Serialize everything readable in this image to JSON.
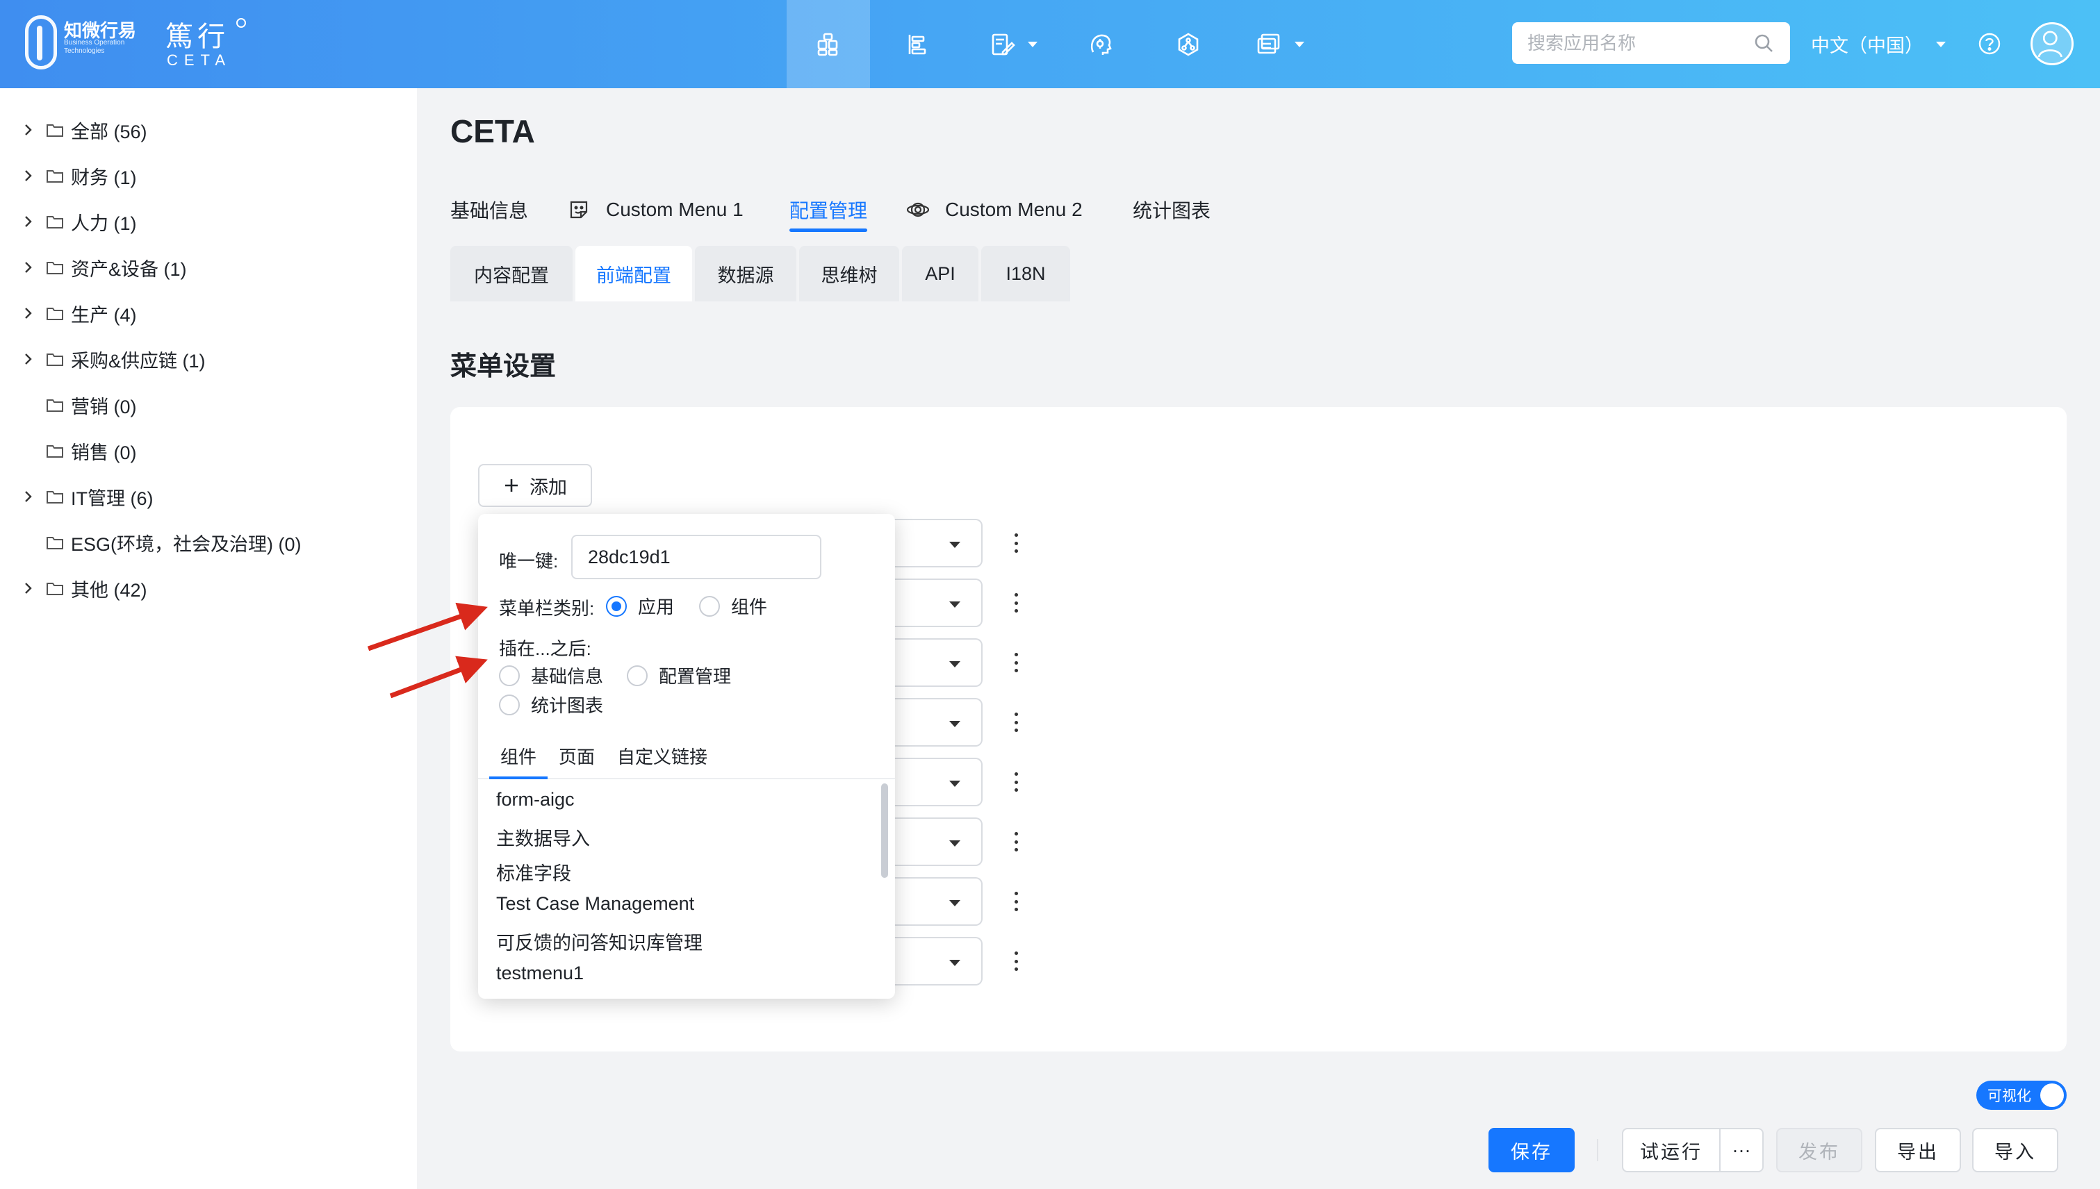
{
  "brand": {
    "logo_cn": "知微行易",
    "logo_en": "Business Operation Technologies",
    "name_cn": "篤行",
    "name_en": "CETA"
  },
  "header": {
    "nav_icons": [
      "app-grid-icon",
      "gantt-icon",
      "form-edit-icon",
      "ai-brain-icon",
      "hexagon-flow-icon",
      "screen-display-icon"
    ],
    "search_placeholder": "搜索应用名称",
    "language": "中文（中国）"
  },
  "sidebar": {
    "items": [
      {
        "label": "全部 (56)",
        "expandable": true
      },
      {
        "label": "财务 (1)",
        "expandable": true
      },
      {
        "label": "人力 (1)",
        "expandable": true
      },
      {
        "label": "资产&设备 (1)",
        "expandable": true
      },
      {
        "label": "生产 (4)",
        "expandable": true
      },
      {
        "label": "采购&供应链 (1)",
        "expandable": true
      },
      {
        "label": "营销 (0)",
        "expandable": false
      },
      {
        "label": "销售 (0)",
        "expandable": false
      },
      {
        "label": "IT管理 (6)",
        "expandable": true
      },
      {
        "label": "ESG(环境，社会及治理) (0)",
        "expandable": false
      },
      {
        "label": "其他 (42)",
        "expandable": true
      }
    ]
  },
  "main": {
    "title": "CETA",
    "tabs": [
      {
        "label": "基础信息"
      },
      {
        "label": "Custom Menu 1"
      },
      {
        "label": "配置管理",
        "active": true
      },
      {
        "label": "Custom Menu 2"
      },
      {
        "label": "统计图表"
      }
    ],
    "subtabs": [
      {
        "label": "内容配置"
      },
      {
        "label": "前端配置",
        "active": true
      },
      {
        "label": "数据源"
      },
      {
        "label": "思维树"
      },
      {
        "label": "API"
      },
      {
        "label": "I18N"
      }
    ],
    "section_title": "菜单设置",
    "add_label": "添加"
  },
  "popover": {
    "key_label": "唯一键:",
    "key_value": "28dc19d1",
    "category_label": "菜单栏类别:",
    "category_options": [
      {
        "label": "应用",
        "selected": true
      },
      {
        "label": "组件",
        "selected": false
      }
    ],
    "insert_after_label": "插在...之后:",
    "insert_options": [
      {
        "label": "基础信息"
      },
      {
        "label": "配置管理"
      },
      {
        "label": "统计图表"
      }
    ],
    "tabs": [
      {
        "label": "组件",
        "active": true
      },
      {
        "label": "页面"
      },
      {
        "label": "自定义链接"
      }
    ],
    "list": [
      "form-aigc",
      "主数据导入",
      "标准字段",
      "Test Case Management",
      "可反馈的问答知识库管理",
      "testmenu1"
    ]
  },
  "footer": {
    "toggle_label": "可视化",
    "toggle_on": true,
    "save": "保存",
    "trial_run": "试运行",
    "more": "···",
    "publish": "发布",
    "export": "导出",
    "import": "导入"
  },
  "colors": {
    "accent": "#1677ff",
    "annotation_arrow": "#d9291c"
  }
}
